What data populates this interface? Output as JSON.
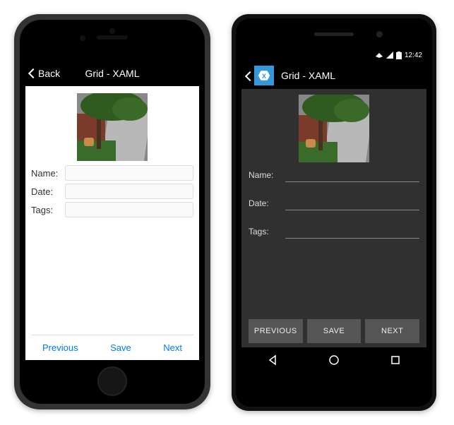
{
  "ios": {
    "nav": {
      "back_label": "Back",
      "title": "Grid - XAML"
    },
    "form": {
      "name_label": "Name:",
      "date_label": "Date:",
      "tags_label": "Tags:",
      "name_value": "",
      "date_value": "",
      "tags_value": ""
    },
    "toolbar": {
      "prev": "Previous",
      "save": "Save",
      "next": "Next"
    }
  },
  "android": {
    "status": {
      "time": "12:42"
    },
    "appbar": {
      "title": "Grid - XAML"
    },
    "form": {
      "name_label": "Name:",
      "date_label": "Date:",
      "tags_label": "Tags:",
      "name_value": "",
      "date_value": "",
      "tags_value": ""
    },
    "buttons": {
      "prev": "PREVIOUS",
      "save": "SAVE",
      "next": "NEXT"
    }
  }
}
